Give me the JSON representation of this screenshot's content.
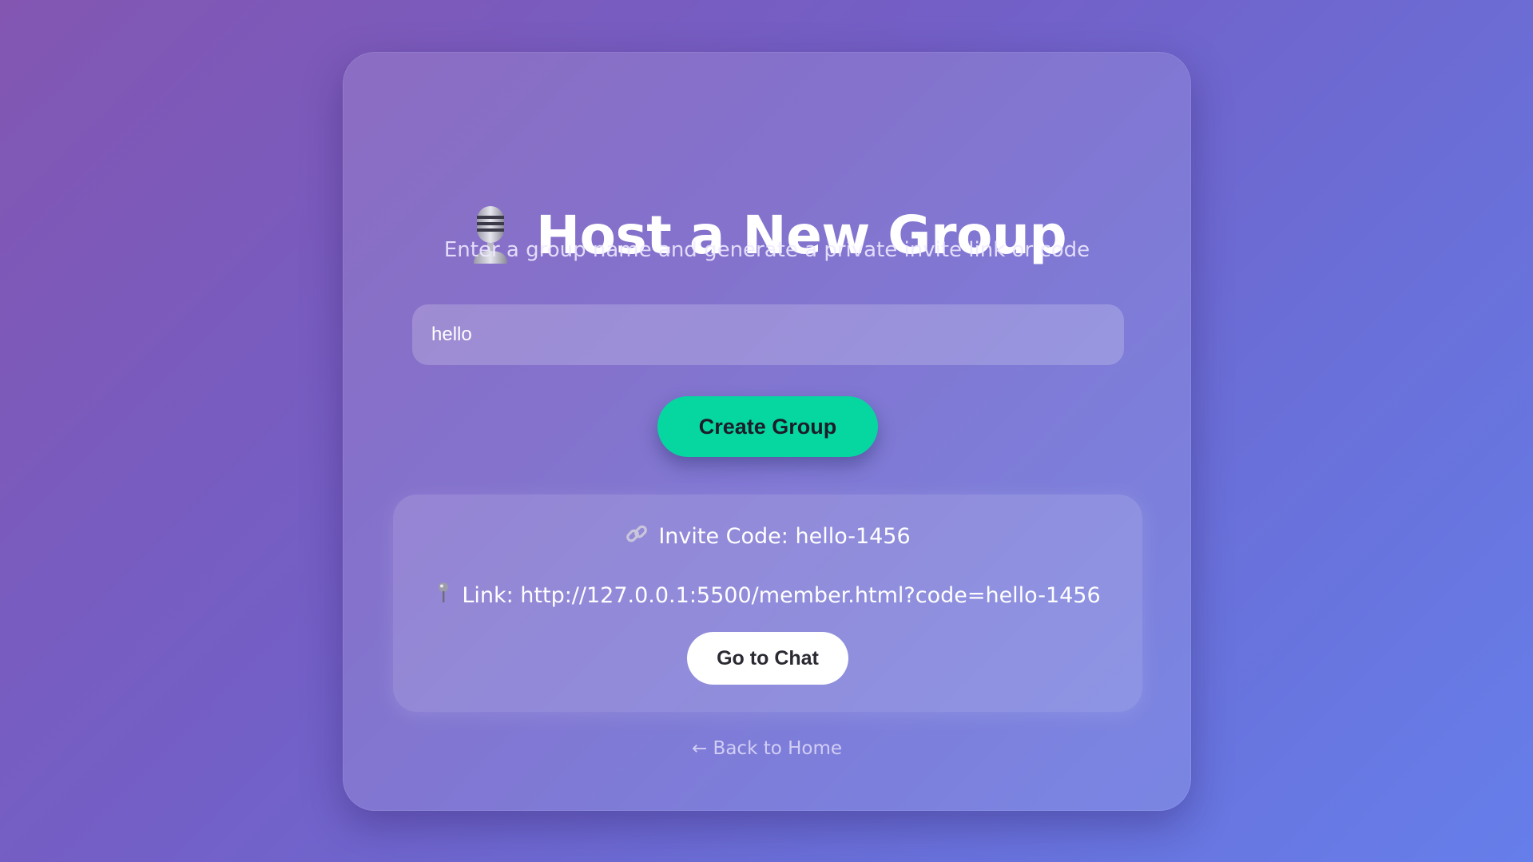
{
  "page": {
    "title": "Host a New Group",
    "title_icon": "microphone-icon",
    "subtitle": "Enter a group name and generate a private invite link or code"
  },
  "form": {
    "group_name_value": "hello",
    "create_button_label": "Create Group"
  },
  "result": {
    "invite_code_text": "Invite Code: hello-1456",
    "invite_code_icon": "chain-link-icon",
    "link_text": "Link: http://127.0.0.1:5500/member.html?code=hello-1456",
    "link_icon": "pushpin-icon",
    "go_chat_label": "Go to Chat"
  },
  "nav": {
    "back_label": "← Back to Home"
  },
  "colors": {
    "accent": "#06d6a0",
    "background_start": "#8356b2",
    "background_end": "#667eea"
  }
}
